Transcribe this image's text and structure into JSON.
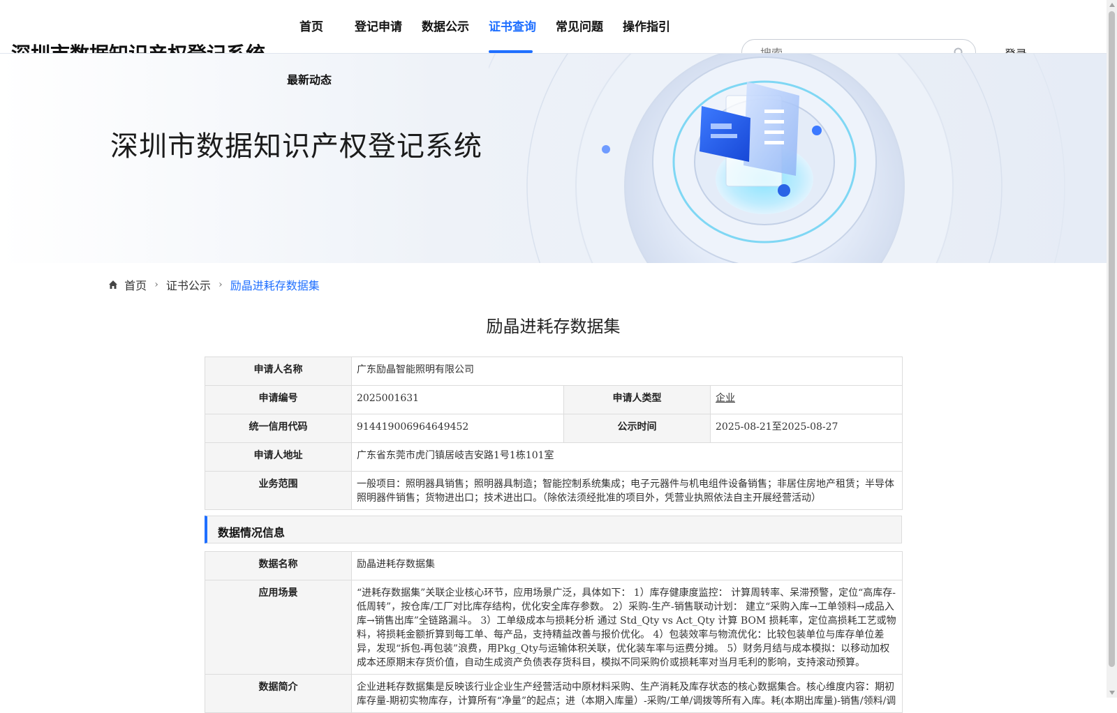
{
  "header": {
    "site_title": "深圳市数据知识产权登记系统",
    "nav": [
      {
        "label": "首页"
      },
      {
        "label": "登记申请"
      },
      {
        "label": "数据公示"
      },
      {
        "label": "证书查询",
        "active": true
      },
      {
        "label": "常见问题"
      },
      {
        "label": "操作指引"
      }
    ],
    "nav_second": "最新动态",
    "search_placeholder": "搜索",
    "login_label": "登录",
    "accent_color": "#1f6fff"
  },
  "banner": {
    "title": "深圳市数据知识产权登记系统"
  },
  "breadcrumb": {
    "home": "首页",
    "parent": "证书公示",
    "current": "励晶进耗存数据集"
  },
  "page_title": "励晶进耗存数据集",
  "applicant": {
    "name_label": "申请人名称",
    "name": "广东励晶智能照明有限公司",
    "code_label": "申请编号",
    "code": "2025001631",
    "type_label": "申请人类型",
    "type": "企业",
    "credit_label": "统一信用代码",
    "credit": "914419006964649452",
    "publish_label": "公示时间",
    "publish": "2025-08-21至2025-08-27",
    "address_label": "申请人地址",
    "address": "广东省东莞市虎门镇居岐吉安路1号1栋101室",
    "scope_label": "业务范围",
    "scope": "一般项目：照明器具销售；照明器具制造；智能控制系统集成；电子元器件与机电组件设备销售；非居住房地产租赁；半导体照明器件销售；货物进出口；技术进出口。（除依法须经批准的项目外，凭营业执照依法自主开展经营活动）"
  },
  "data_section": {
    "title": "数据情况信息",
    "name_label": "数据名称",
    "name": "励晶进耗存数据集",
    "scenario_label": "应用场景",
    "scenario": "“进耗存数据集”关联企业核心环节，应用场景广泛，具体如下： 1）库存健康度监控： 计算周转率、呆滞预警，定位“高库存-低周转”，按仓库/工厂对比库存结构，优化安全库存参数。 2）采购-生产-销售联动计划： 建立“采购入库→工单领料→成品入库→销售出库”全链路漏斗。 3）工单级成本与损耗分析 通过 Std_Qty vs Act_Qty 计算 BOM 损耗率，定位高损耗工艺或物料，将损耗金额折算到每工单、每产品，支持精益改善与报价优化。 4）包装效率与物流优化：比较包装单位与库存单位差异，发现“拆包-再包装”浪费，用Pkg_Qty与运输体积关联，优化装车率与运费分摊。 5）财务月结与成本模拟：以移动加权成本还原期末存货价值，自动生成资产负债表存货科目，模拟不同采购价或损耗率对当月毛利的影响，支持滚动预算。",
    "intro_label": "数据简介",
    "intro": "企业进耗存数据集是反映该行业企业生产经营活动中原材料采购、生产消耗及库存状态的核心数据集合。核心维度内容：期初库存量-期初实物库存，计算所有“净量”的起点；进（本期入库量）-采购/工单/调拨等所有入库。耗(本期出库量)-销售/领料/调"
  }
}
